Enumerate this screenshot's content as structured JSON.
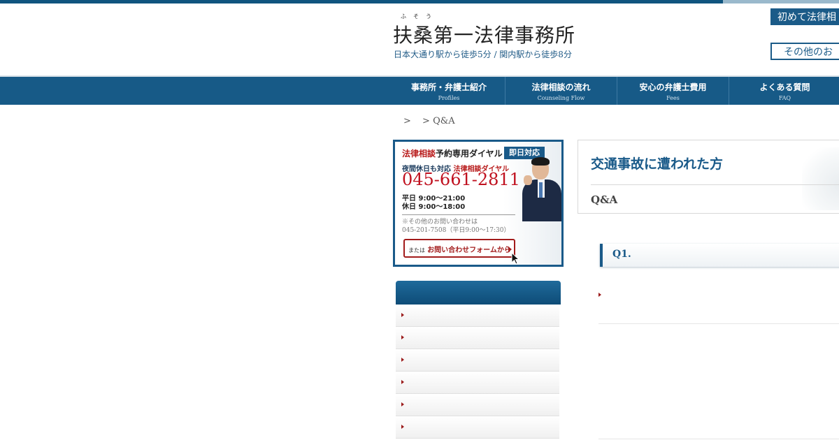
{
  "header": {
    "ruby": "ふそう",
    "logo": "扶桑第一法律事務所",
    "tagline": "日本大通り駅から徒歩5分 / 関内駅から徒歩8分",
    "button_first": "初めて法律相",
    "button_other": "その他のお"
  },
  "nav": {
    "items": [
      {
        "label": "事務所・弁護士紹介",
        "sub": "Profiles"
      },
      {
        "label": "法律相談の流れ",
        "sub": "Counseling Flow"
      },
      {
        "label": "安心の弁護士費用",
        "sub": "Fees"
      },
      {
        "label": "よくある質問",
        "sub": "FAQ"
      }
    ]
  },
  "breadcrumb": {
    "sep1": ">",
    "current": "> Q&A"
  },
  "banner": {
    "title_red": "法律相談",
    "title_black": "予約専用ダイヤル",
    "badge": "即日対応",
    "sub_black": "夜間休日も対応",
    "sub_red": "法律相談ダイヤル",
    "phone": "045-661-2811",
    "hours_weekday": "平日 9:00〜21:00",
    "hours_holiday": "休日 9:00〜18:00",
    "note1": "※その他のお問い合わせは",
    "note2": "045-201-7508（平日9:00〜17:30）",
    "form_prefix": "または",
    "form_label": "お問い合わせフォームから"
  },
  "content": {
    "title": "交通事故に遭われた方",
    "subtitle": "Q&A",
    "question_label": "Q1."
  },
  "colors": {
    "brand": "#175a87",
    "accent_red": "#c0111f"
  }
}
